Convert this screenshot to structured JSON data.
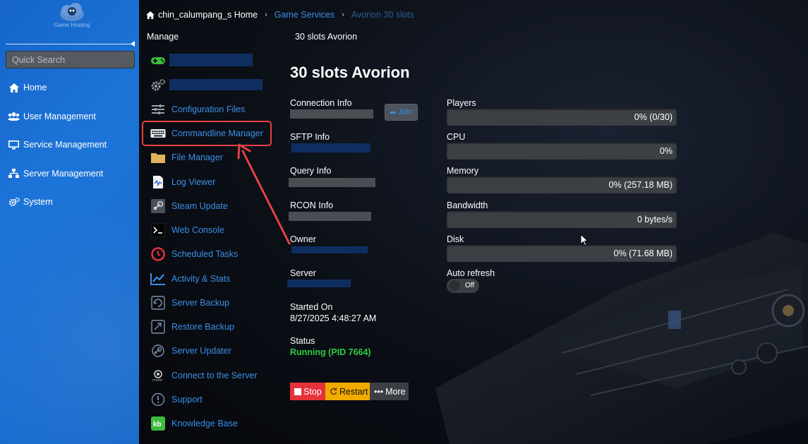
{
  "sidebar": {
    "logo_text": "Game Hosting",
    "search_placeholder": "Quick Search",
    "items": [
      {
        "label": "Home",
        "icon": "home-icon"
      },
      {
        "label": "User Management",
        "icon": "users-icon"
      },
      {
        "label": "Service Management",
        "icon": "monitor-icon"
      },
      {
        "label": "Server Management",
        "icon": "network-icon"
      },
      {
        "label": "System",
        "icon": "gears-icon"
      }
    ]
  },
  "breadcrumb": {
    "home": "chin_calumpang_s Home",
    "section": "Game Services",
    "current": "Avorion 30 slots"
  },
  "subheader": {
    "manage": "Manage",
    "service_name": "30 slots Avorion"
  },
  "manage_menu": [
    {
      "label": "Configuration Files",
      "icon": "sliders-icon"
    },
    {
      "label": "Commandline Manager",
      "icon": "keyboard-icon",
      "highlighted": true
    },
    {
      "label": "File Manager",
      "icon": "folder-icon"
    },
    {
      "label": "Log Viewer",
      "icon": "log-file-icon"
    },
    {
      "label": "Steam Update",
      "icon": "steam-icon"
    },
    {
      "label": "Web Console",
      "icon": "terminal-icon"
    },
    {
      "label": "Scheduled Tasks",
      "icon": "clock-icon"
    },
    {
      "label": "Activity & Stats",
      "icon": "chart-icon"
    },
    {
      "label": "Server Backup",
      "icon": "backup-icon"
    },
    {
      "label": "Restore Backup",
      "icon": "restore-icon"
    },
    {
      "label": "Server Updater",
      "icon": "updater-icon"
    },
    {
      "label": "Connect to the Server",
      "icon": "steam-connect-icon"
    },
    {
      "label": "Support",
      "icon": "support-icon"
    },
    {
      "label": "Knowledge Base",
      "icon": "kb-icon"
    }
  ],
  "info": {
    "title": "30 slots Avorion",
    "connection_label": "Connection Info",
    "join_label": "Join",
    "sftp_label": "SFTP Info",
    "query_label": "Query Info",
    "rcon_label": "RCON Info",
    "owner_label": "Owner",
    "server_label": "Server",
    "started_label": "Started On",
    "started_value": "8/27/2025 4:48:27 AM",
    "status_label": "Status",
    "status_value": "Running (PID 7664)"
  },
  "metrics": [
    {
      "label": "Players",
      "value": "0% (0/30)",
      "percent": 0
    },
    {
      "label": "CPU",
      "value": "0%",
      "percent": 0
    },
    {
      "label": "Memory",
      "value": "0% (257.18 MB)",
      "percent": 0
    },
    {
      "label": "Bandwidth",
      "value": "0 bytes/s",
      "percent": 0
    },
    {
      "label": "Disk",
      "value": "0% (71.68 MB)",
      "percent": 0
    }
  ],
  "auto_refresh": {
    "label": "Auto refresh",
    "state": "Off"
  },
  "actions": {
    "stop": "Stop",
    "restart": "Restart",
    "more": "More"
  },
  "colors": {
    "link": "#3b8fe6",
    "sidebar": "#1d74d8",
    "running": "#2ecc40",
    "stop": "#e5323a",
    "restart": "#f0ab00",
    "annotation": "#e74045"
  }
}
